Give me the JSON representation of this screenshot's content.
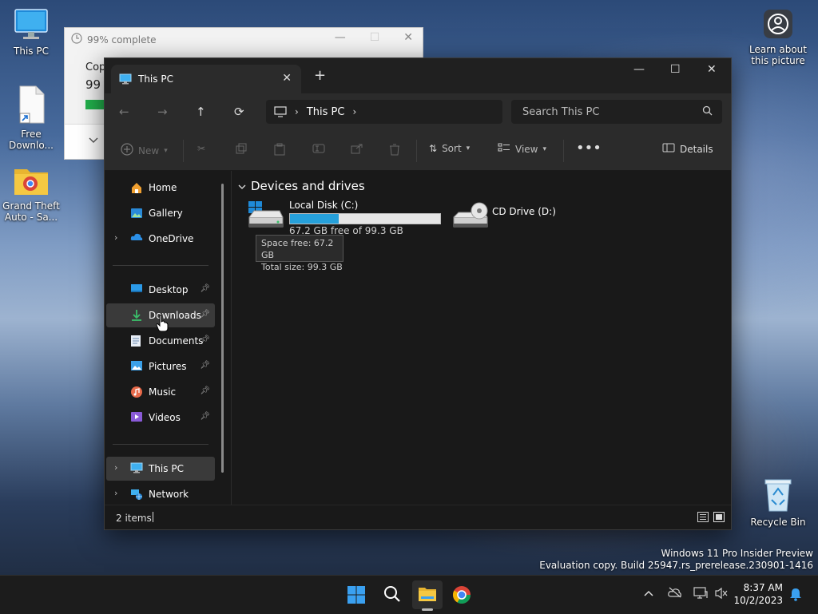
{
  "desktop": {
    "icons": [
      {
        "label": "This PC"
      },
      {
        "label": "Free Downlo..."
      },
      {
        "label": "Grand Theft Auto - Sa..."
      },
      {
        "label": "Learn about this picture"
      },
      {
        "label": "Recycle Bin"
      }
    ],
    "watermark": {
      "line1": "Windows 11 Pro Insider Preview",
      "line2": "Evaluation copy. Build 25947.rs_prerelease.230901-1416"
    }
  },
  "copy_dialog": {
    "title": "99% complete",
    "line1": "Cop",
    "line2": "99",
    "progress_percent": 99
  },
  "explorer": {
    "tab_title": "This PC",
    "address": {
      "segment": "This PC"
    },
    "search_placeholder": "Search This PC",
    "toolbar": {
      "new": "New",
      "sort": "Sort",
      "view": "View",
      "details": "Details"
    },
    "nav": {
      "home": "Home",
      "gallery": "Gallery",
      "onedrive": "OneDrive",
      "desktop": "Desktop",
      "downloads": "Downloads",
      "documents": "Documents",
      "pictures": "Pictures",
      "music": "Music",
      "videos": "Videos",
      "thispc": "This PC",
      "network": "Network"
    },
    "group_header": "Devices and drives",
    "drives": [
      {
        "name": "Local Disk (C:)",
        "free_text": "67.2 GB free of 99.3 GB",
        "used_fraction": 0.323
      },
      {
        "name": "CD Drive (D:)"
      }
    ],
    "tooltip": {
      "line1": "Space free: 67.2 GB",
      "line2": "Total size: 99.3 GB"
    },
    "status": "2 items"
  },
  "taskbar": {
    "time": "8:37 AM",
    "date": "10/2/2023"
  },
  "colors": {
    "accent": "#26a0da",
    "explorer_bg": "#191919",
    "toolbar_bg": "#2b2b2b",
    "copy_progress": "#22b14c"
  }
}
